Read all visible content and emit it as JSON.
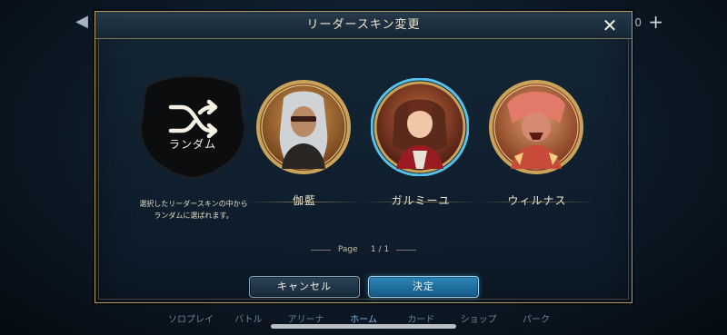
{
  "dialog": {
    "title": "リーダースキン変更",
    "close_glyph": "✕"
  },
  "random": {
    "label": "ランダム",
    "description_line1": "選択したリーダースキンの中から",
    "description_line2": "ランダムに選ばれます。"
  },
  "skins": [
    {
      "name": "伽藍",
      "selected": false
    },
    {
      "name": "ガルミーユ",
      "selected": true
    },
    {
      "name": "ウィルナス",
      "selected": false
    }
  ],
  "pager": {
    "label": "Page",
    "current": "1",
    "separator": "/",
    "total": "1"
  },
  "buttons": {
    "cancel": "キャンセル",
    "confirm": "決定"
  },
  "background": {
    "zero": "0",
    "nav": [
      "ソロプレイ",
      "バトル",
      "アリーナ",
      "ホーム",
      "カード",
      "ショップ",
      "パーク"
    ],
    "active_nav": "ホーム"
  },
  "colors": {
    "gold_frame": "#c9a35a",
    "selected_glow": "#5fd4ff",
    "confirm_button": "#2c86b8"
  }
}
